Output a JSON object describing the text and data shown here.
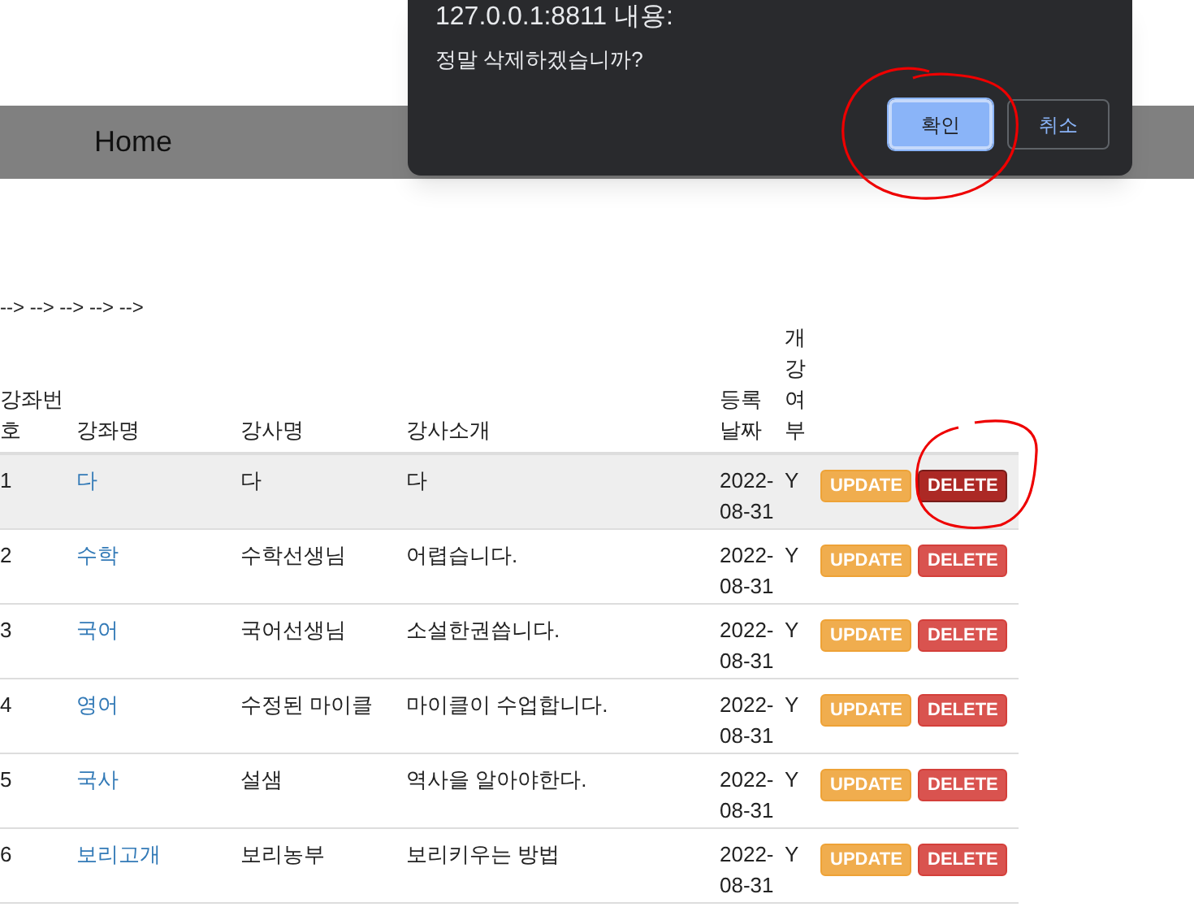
{
  "nav": {
    "items": [
      {
        "label": "Home"
      }
    ]
  },
  "dialog": {
    "title": "127.0.0.1:8811 내용:",
    "message": "정말 삭제하겠습니까?",
    "buttons": [
      {
        "label": "확인",
        "kind": "primary"
      },
      {
        "label": "취소",
        "kind": "secondary"
      }
    ]
  },
  "comment_text": "--> --> --> --> -->",
  "table": {
    "columns": [
      "강좌번호",
      "강좌명",
      "강사명",
      "강사소개",
      "등록날짜",
      "개강여부"
    ],
    "rows": [
      {
        "cells": [
          "1",
          "다",
          "다",
          "다",
          "2022-08-31",
          "Y"
        ],
        "highlighted": true,
        "update": "UPDATE",
        "delete": "DELETE",
        "delete_hovered": true
      },
      {
        "cells": [
          "2",
          "수학",
          "수학선생님",
          "어렵습니다.",
          "2022-08-31",
          "Y"
        ],
        "highlighted": false,
        "update": "UPDATE",
        "delete": "DELETE",
        "delete_hovered": false
      },
      {
        "cells": [
          "3",
          "국어",
          "국어선생님",
          "소설한권씁니다.",
          "2022-08-31",
          "Y"
        ],
        "highlighted": false,
        "update": "UPDATE",
        "delete": "DELETE",
        "delete_hovered": false
      },
      {
        "cells": [
          "4",
          "영어",
          "수정된 마이클",
          "마이클이 수업합니다.",
          "2022-08-31",
          "Y"
        ],
        "highlighted": false,
        "update": "UPDATE",
        "delete": "DELETE",
        "delete_hovered": false
      },
      {
        "cells": [
          "5",
          "국사",
          "설샘",
          "역사을 알아야한다.",
          "2022-08-31",
          "Y"
        ],
        "highlighted": false,
        "update": "UPDATE",
        "delete": "DELETE",
        "delete_hovered": false
      },
      {
        "cells": [
          "6",
          "보리고개",
          "보리농부",
          "보리키우는 방법",
          "2022-08-31",
          "Y"
        ],
        "highlighted": false,
        "update": "UPDATE",
        "delete": "DELETE",
        "delete_hovered": false
      }
    ]
  }
}
